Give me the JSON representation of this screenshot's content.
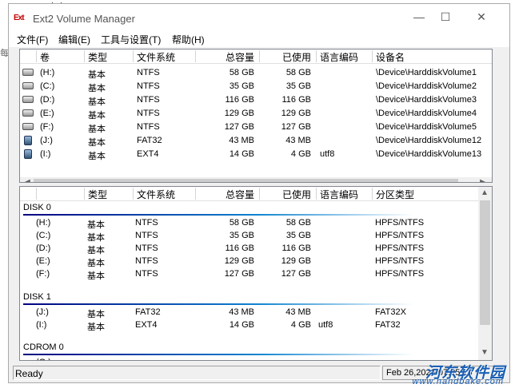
{
  "background": {
    "fragment_top": "大小",
    "fragment_left": "每"
  },
  "window": {
    "title": "Ext2 Volume Manager",
    "app_icon": "Ext",
    "controls": {
      "minimize": "—",
      "maximize": "☐",
      "close": "✕"
    }
  },
  "menu": [
    "文件(F)",
    "编辑(E)",
    "工具与设置(T)",
    "帮助(H)"
  ],
  "volumes": {
    "headers": [
      "卷",
      "类型",
      "文件系统",
      "总容量",
      "已使用",
      "语言编码",
      "设备名"
    ],
    "rows": [
      {
        "icon": "hard-drive-icon",
        "vol": "(H:)",
        "type": "基本",
        "fs": "NTFS",
        "total": "58 GB",
        "used": "58 GB",
        "codepage": "",
        "device": "\\Device\\HarddiskVolume1"
      },
      {
        "icon": "hard-drive-icon",
        "vol": "(C:)",
        "type": "基本",
        "fs": "NTFS",
        "total": "35 GB",
        "used": "35 GB",
        "codepage": "",
        "device": "\\Device\\HarddiskVolume2"
      },
      {
        "icon": "hard-drive-icon",
        "vol": "(D:)",
        "type": "基本",
        "fs": "NTFS",
        "total": "116 GB",
        "used": "116 GB",
        "codepage": "",
        "device": "\\Device\\HarddiskVolume3"
      },
      {
        "icon": "hard-drive-icon",
        "vol": "(E:)",
        "type": "基本",
        "fs": "NTFS",
        "total": "129 GB",
        "used": "129 GB",
        "codepage": "",
        "device": "\\Device\\HarddiskVolume4"
      },
      {
        "icon": "hard-drive-icon",
        "vol": "(F:)",
        "type": "基本",
        "fs": "NTFS",
        "total": "127 GB",
        "used": "127 GB",
        "codepage": "",
        "device": "\\Device\\HarddiskVolume5"
      },
      {
        "icon": "usb-drive-icon",
        "vol": "(J:)",
        "type": "基本",
        "fs": "FAT32",
        "total": "43 MB",
        "used": "43 MB",
        "codepage": "",
        "device": "\\Device\\HarddiskVolume12"
      },
      {
        "icon": "usb-drive-icon",
        "vol": "(I:)",
        "type": "基本",
        "fs": "EXT4",
        "total": "14 GB",
        "used": "4 GB",
        "codepage": "utf8",
        "device": "\\Device\\HarddiskVolume13"
      }
    ]
  },
  "partitions": {
    "headers": [
      "",
      "类型",
      "文件系统",
      "总容量",
      "已使用",
      "语言编码",
      "分区类型"
    ],
    "disk0_label": "DISK 0",
    "disk0": [
      {
        "vol": "(H:)",
        "type": "基本",
        "fs": "NTFS",
        "total": "58 GB",
        "used": "58 GB",
        "codepage": "",
        "ptype": "HPFS/NTFS"
      },
      {
        "vol": "(C:)",
        "type": "基本",
        "fs": "NTFS",
        "total": "35 GB",
        "used": "35 GB",
        "codepage": "",
        "ptype": "HPFS/NTFS"
      },
      {
        "vol": "(D:)",
        "type": "基本",
        "fs": "NTFS",
        "total": "116 GB",
        "used": "116 GB",
        "codepage": "",
        "ptype": "HPFS/NTFS"
      },
      {
        "vol": "(E:)",
        "type": "基本",
        "fs": "NTFS",
        "total": "129 GB",
        "used": "129 GB",
        "codepage": "",
        "ptype": "HPFS/NTFS"
      },
      {
        "vol": "(F:)",
        "type": "基本",
        "fs": "NTFS",
        "total": "127 GB",
        "used": "127 GB",
        "codepage": "",
        "ptype": "HPFS/NTFS"
      }
    ],
    "disk1_label": "DISK 1",
    "disk1": [
      {
        "vol": "(J:)",
        "type": "基本",
        "fs": "FAT32",
        "total": "43 MB",
        "used": "43 MB",
        "codepage": "",
        "ptype": "FAT32X"
      },
      {
        "vol": "(I:)",
        "type": "基本",
        "fs": "EXT4",
        "total": "14 GB",
        "used": "4 GB",
        "codepage": "utf8",
        "ptype": "FAT32"
      }
    ],
    "cdrom0_label": "CDROM 0",
    "cdrom0": [
      {
        "vol": "(G:)"
      }
    ]
  },
  "status": {
    "left": "Ready",
    "right": "Feb 26,2020 07:25:15"
  },
  "watermark": {
    "cn": "河东软件园",
    "url": "www.handbake.com"
  }
}
